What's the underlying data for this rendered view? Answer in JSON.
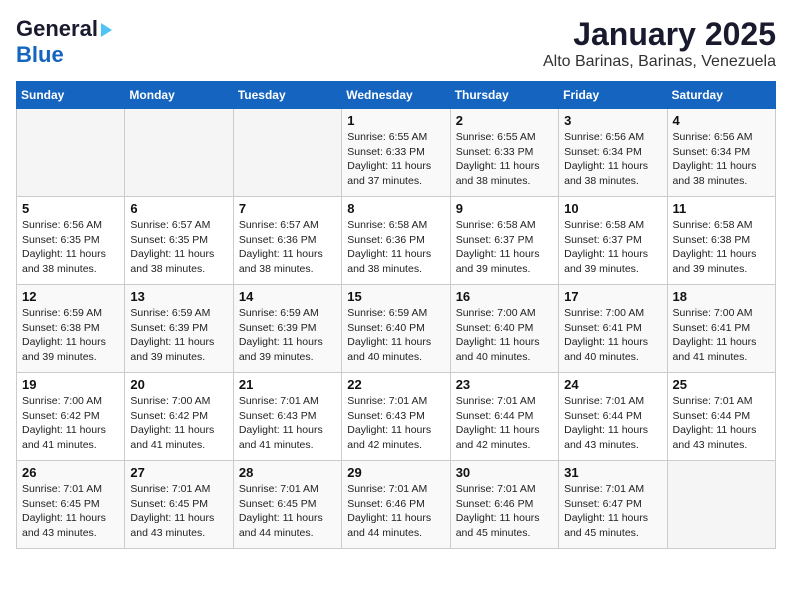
{
  "header": {
    "logo_line1": "General",
    "logo_line2": "Blue",
    "title": "January 2025",
    "subtitle": "Alto Barinas, Barinas, Venezuela"
  },
  "weekdays": [
    "Sunday",
    "Monday",
    "Tuesday",
    "Wednesday",
    "Thursday",
    "Friday",
    "Saturday"
  ],
  "weeks": [
    [
      {
        "day": "",
        "sunrise": "",
        "sunset": "",
        "daylight": ""
      },
      {
        "day": "",
        "sunrise": "",
        "sunset": "",
        "daylight": ""
      },
      {
        "day": "",
        "sunrise": "",
        "sunset": "",
        "daylight": ""
      },
      {
        "day": "1",
        "sunrise": "Sunrise: 6:55 AM",
        "sunset": "Sunset: 6:33 PM",
        "daylight": "Daylight: 11 hours and 37 minutes."
      },
      {
        "day": "2",
        "sunrise": "Sunrise: 6:55 AM",
        "sunset": "Sunset: 6:33 PM",
        "daylight": "Daylight: 11 hours and 38 minutes."
      },
      {
        "day": "3",
        "sunrise": "Sunrise: 6:56 AM",
        "sunset": "Sunset: 6:34 PM",
        "daylight": "Daylight: 11 hours and 38 minutes."
      },
      {
        "day": "4",
        "sunrise": "Sunrise: 6:56 AM",
        "sunset": "Sunset: 6:34 PM",
        "daylight": "Daylight: 11 hours and 38 minutes."
      }
    ],
    [
      {
        "day": "5",
        "sunrise": "Sunrise: 6:56 AM",
        "sunset": "Sunset: 6:35 PM",
        "daylight": "Daylight: 11 hours and 38 minutes."
      },
      {
        "day": "6",
        "sunrise": "Sunrise: 6:57 AM",
        "sunset": "Sunset: 6:35 PM",
        "daylight": "Daylight: 11 hours and 38 minutes."
      },
      {
        "day": "7",
        "sunrise": "Sunrise: 6:57 AM",
        "sunset": "Sunset: 6:36 PM",
        "daylight": "Daylight: 11 hours and 38 minutes."
      },
      {
        "day": "8",
        "sunrise": "Sunrise: 6:58 AM",
        "sunset": "Sunset: 6:36 PM",
        "daylight": "Daylight: 11 hours and 38 minutes."
      },
      {
        "day": "9",
        "sunrise": "Sunrise: 6:58 AM",
        "sunset": "Sunset: 6:37 PM",
        "daylight": "Daylight: 11 hours and 39 minutes."
      },
      {
        "day": "10",
        "sunrise": "Sunrise: 6:58 AM",
        "sunset": "Sunset: 6:37 PM",
        "daylight": "Daylight: 11 hours and 39 minutes."
      },
      {
        "day": "11",
        "sunrise": "Sunrise: 6:58 AM",
        "sunset": "Sunset: 6:38 PM",
        "daylight": "Daylight: 11 hours and 39 minutes."
      }
    ],
    [
      {
        "day": "12",
        "sunrise": "Sunrise: 6:59 AM",
        "sunset": "Sunset: 6:38 PM",
        "daylight": "Daylight: 11 hours and 39 minutes."
      },
      {
        "day": "13",
        "sunrise": "Sunrise: 6:59 AM",
        "sunset": "Sunset: 6:39 PM",
        "daylight": "Daylight: 11 hours and 39 minutes."
      },
      {
        "day": "14",
        "sunrise": "Sunrise: 6:59 AM",
        "sunset": "Sunset: 6:39 PM",
        "daylight": "Daylight: 11 hours and 39 minutes."
      },
      {
        "day": "15",
        "sunrise": "Sunrise: 6:59 AM",
        "sunset": "Sunset: 6:40 PM",
        "daylight": "Daylight: 11 hours and 40 minutes."
      },
      {
        "day": "16",
        "sunrise": "Sunrise: 7:00 AM",
        "sunset": "Sunset: 6:40 PM",
        "daylight": "Daylight: 11 hours and 40 minutes."
      },
      {
        "day": "17",
        "sunrise": "Sunrise: 7:00 AM",
        "sunset": "Sunset: 6:41 PM",
        "daylight": "Daylight: 11 hours and 40 minutes."
      },
      {
        "day": "18",
        "sunrise": "Sunrise: 7:00 AM",
        "sunset": "Sunset: 6:41 PM",
        "daylight": "Daylight: 11 hours and 41 minutes."
      }
    ],
    [
      {
        "day": "19",
        "sunrise": "Sunrise: 7:00 AM",
        "sunset": "Sunset: 6:42 PM",
        "daylight": "Daylight: 11 hours and 41 minutes."
      },
      {
        "day": "20",
        "sunrise": "Sunrise: 7:00 AM",
        "sunset": "Sunset: 6:42 PM",
        "daylight": "Daylight: 11 hours and 41 minutes."
      },
      {
        "day": "21",
        "sunrise": "Sunrise: 7:01 AM",
        "sunset": "Sunset: 6:43 PM",
        "daylight": "Daylight: 11 hours and 41 minutes."
      },
      {
        "day": "22",
        "sunrise": "Sunrise: 7:01 AM",
        "sunset": "Sunset: 6:43 PM",
        "daylight": "Daylight: 11 hours and 42 minutes."
      },
      {
        "day": "23",
        "sunrise": "Sunrise: 7:01 AM",
        "sunset": "Sunset: 6:44 PM",
        "daylight": "Daylight: 11 hours and 42 minutes."
      },
      {
        "day": "24",
        "sunrise": "Sunrise: 7:01 AM",
        "sunset": "Sunset: 6:44 PM",
        "daylight": "Daylight: 11 hours and 43 minutes."
      },
      {
        "day": "25",
        "sunrise": "Sunrise: 7:01 AM",
        "sunset": "Sunset: 6:44 PM",
        "daylight": "Daylight: 11 hours and 43 minutes."
      }
    ],
    [
      {
        "day": "26",
        "sunrise": "Sunrise: 7:01 AM",
        "sunset": "Sunset: 6:45 PM",
        "daylight": "Daylight: 11 hours and 43 minutes."
      },
      {
        "day": "27",
        "sunrise": "Sunrise: 7:01 AM",
        "sunset": "Sunset: 6:45 PM",
        "daylight": "Daylight: 11 hours and 43 minutes."
      },
      {
        "day": "28",
        "sunrise": "Sunrise: 7:01 AM",
        "sunset": "Sunset: 6:45 PM",
        "daylight": "Daylight: 11 hours and 44 minutes."
      },
      {
        "day": "29",
        "sunrise": "Sunrise: 7:01 AM",
        "sunset": "Sunset: 6:46 PM",
        "daylight": "Daylight: 11 hours and 44 minutes."
      },
      {
        "day": "30",
        "sunrise": "Sunrise: 7:01 AM",
        "sunset": "Sunset: 6:46 PM",
        "daylight": "Daylight: 11 hours and 45 minutes."
      },
      {
        "day": "31",
        "sunrise": "Sunrise: 7:01 AM",
        "sunset": "Sunset: 6:47 PM",
        "daylight": "Daylight: 11 hours and 45 minutes."
      },
      {
        "day": "",
        "sunrise": "",
        "sunset": "",
        "daylight": ""
      }
    ]
  ]
}
